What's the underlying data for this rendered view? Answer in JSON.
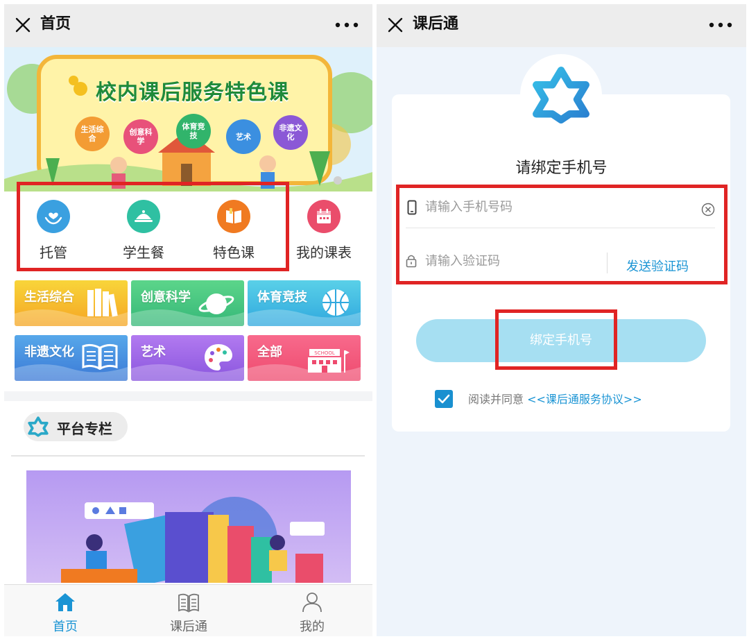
{
  "left": {
    "topbar": {
      "title": "首页",
      "close_icon": "close-icon",
      "more_icon": "more-icon"
    },
    "banner": {
      "title": "校内课后服务特色课",
      "bubbles": [
        "生活综合",
        "创意科学",
        "体育竞技",
        "艺术",
        "非遗文化"
      ]
    },
    "quick_menu": [
      {
        "label": "托管",
        "icon": "hand-heart-icon",
        "color": "#3aa0e0"
      },
      {
        "label": "学生餐",
        "icon": "food-cover-icon",
        "color": "#2fc0a2"
      },
      {
        "label": "特色课",
        "icon": "book-icon",
        "color": "#f07a21"
      },
      {
        "label": "我的课表",
        "icon": "calendar-icon",
        "color": "#ea4d6b"
      }
    ],
    "categories": [
      {
        "label": "生活综合",
        "icon": "books-icon",
        "color_top": "#f8d53a",
        "color_bottom": "#f5a524"
      },
      {
        "label": "创意科学",
        "icon": "planet-icon",
        "color_top": "#5cd58a",
        "color_bottom": "#35b778"
      },
      {
        "label": "体育竞技",
        "icon": "basketball-icon",
        "color_top": "#5ad0e8",
        "color_bottom": "#2fa8de"
      },
      {
        "label": "非遗文化",
        "icon": "open-book-icon",
        "color_top": "#57a8ea",
        "color_bottom": "#3b79d6"
      },
      {
        "label": "艺术",
        "icon": "palette-icon",
        "color_top": "#b27af0",
        "color_bottom": "#8a56de"
      },
      {
        "label": "全部",
        "icon": "school-icon",
        "color_top": "#f86a8c",
        "color_bottom": "#ee4a6e"
      }
    ],
    "school_sign": "SCHOOL",
    "platform_section": {
      "title": "平台专栏",
      "icon": "app-logo-icon"
    },
    "tabbar": [
      {
        "label": "首页",
        "icon": "home-icon",
        "active": true
      },
      {
        "label": "课后通",
        "icon": "book-icon",
        "active": false
      },
      {
        "label": "我的",
        "icon": "user-icon",
        "active": false
      }
    ],
    "colors": {
      "accent": "#1a94d4",
      "highlight": "#e02424"
    }
  },
  "right": {
    "topbar": {
      "title": "课后通",
      "close_icon": "close-icon",
      "more_icon": "more-icon"
    },
    "logo_icon": "app-logo-icon",
    "bind_title": "请绑定手机号",
    "phone_placeholder": "请输入手机号码",
    "code_placeholder": "请输入验证码",
    "send_code": "发送验证码",
    "bind_button": "绑定手机号",
    "agree_text": "阅读并同意",
    "agree_link": "<<课后通服务协议>>",
    "agree_checked": true
  }
}
